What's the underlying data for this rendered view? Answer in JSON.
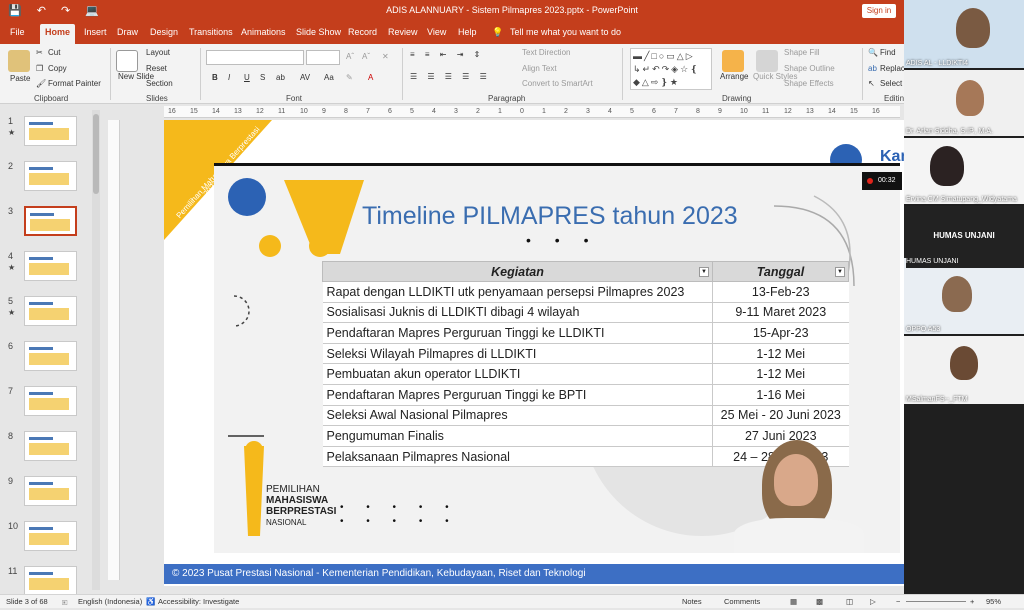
{
  "window": {
    "title": "ADIS ALANNUARY - Sistem Pilmapres 2023.pptx - PowerPoint",
    "signin_label": "Sign in"
  },
  "tabs": [
    "File",
    "Home",
    "Insert",
    "Draw",
    "Design",
    "Transitions",
    "Animations",
    "Slide Show",
    "Record",
    "Review",
    "View",
    "Help"
  ],
  "active_tab": "Home",
  "tell_me": "Tell me what you want to do",
  "ribbon": {
    "clipboard": {
      "label": "Clipboard",
      "paste": "Paste",
      "cut": "Cut",
      "copy": "Copy",
      "format_painter": "Format Painter"
    },
    "slides": {
      "label": "Slides",
      "new_slide": "New Slide",
      "layout": "Layout",
      "reset": "Reset",
      "section": "Section"
    },
    "font": {
      "label": "Font",
      "bold": "B",
      "italic": "I",
      "underline": "U",
      "strike": "S",
      "shadow": "ab",
      "case": "AV",
      "aa": "Aa",
      "font_color": "A"
    },
    "paragraph": {
      "label": "Paragraph",
      "text_direction": "Text Direction",
      "align_text": "Align Text",
      "smartart": "Convert to SmartArt"
    },
    "drawing": {
      "label": "Drawing",
      "arrange": "Arrange",
      "quick_styles": "Quick Styles",
      "shape_fill": "Shape Fill",
      "shape_outline": "Shape Outline",
      "shape_effects": "Shape Effects"
    },
    "editing": {
      "label": "Editing",
      "find": "Find",
      "replace": "Replac",
      "select": "Select"
    }
  },
  "thumbnails": [
    {
      "num": "1",
      "star": "★"
    },
    {
      "num": "2",
      "star": ""
    },
    {
      "num": "3",
      "star": ""
    },
    {
      "num": "4",
      "star": "★"
    },
    {
      "num": "5",
      "star": "★"
    },
    {
      "num": "6",
      "star": ""
    },
    {
      "num": "7",
      "star": ""
    },
    {
      "num": "8",
      "star": ""
    },
    {
      "num": "9",
      "star": ""
    },
    {
      "num": "10",
      "star": ""
    },
    {
      "num": "11",
      "star": ""
    }
  ],
  "ruler_ticks": [
    "16",
    "15",
    "14",
    "13",
    "12",
    "11",
    "10",
    "9",
    "8",
    "7",
    "6",
    "5",
    "4",
    "3",
    "2",
    "1",
    "0",
    "1",
    "2",
    "3",
    "4",
    "5",
    "6",
    "7",
    "8",
    "9",
    "10",
    "11",
    "12",
    "13",
    "14",
    "15",
    "16"
  ],
  "slide": {
    "banner_text": "Pemilihan Mahasiswa Berprestasi",
    "banner_year": "2023",
    "title": "Timeline PILMAPRES tahun 2023",
    "table": {
      "headers": [
        "Kegiatan",
        "Tanggal"
      ],
      "rows": [
        [
          "Rapat dengan LLDIKTI utk penyamaan persepsi Pilmapres 2023",
          "13-Feb-23"
        ],
        [
          "Sosialisasi Juknis di LLDIKTI dibagi 4 wilayah",
          "9-11 Maret 2023"
        ],
        [
          "Pendaftaran Mapres Perguruan Tinggi ke LLDIKTI",
          "15-Apr-23"
        ],
        [
          "Seleksi Wilayah Pilmapres di LLDIKTI",
          "1-12 Mei"
        ],
        [
          "Pembuatan akun operator LLDIKTI",
          "1-12 Mei"
        ],
        [
          "Pendaftaran Mapres Perguruan Tinggi ke BPTI",
          "1-16 Mei"
        ],
        [
          "Seleksi Awal Nasional Pilmapres",
          "25 Mei - 20 Juni 2023"
        ],
        [
          "Pengumuman Finalis",
          "27 Juni 2023"
        ],
        [
          "Pelaksanaan Pilmapres Nasional",
          "24 – 28 Juli 2023"
        ]
      ]
    },
    "logo_lines": [
      "PEMILIHAN",
      "MAHASISWA",
      "BERPRESTASI",
      "NASIONAL"
    ],
    "footer": "© 2023 Pusat Prestasi Nasional - Kementerian Pendidikan, Kebudayaan, Riset dan Teknologi",
    "corner_text": "Kam",
    "recording_time": "00:32"
  },
  "participants": [
    {
      "name": "ADIS AL - LLDIKTI4"
    },
    {
      "name": "Dr. Arlan Siddha, S.IP., M.A."
    },
    {
      "name": "Ervina CM Simatupang_Widyatama"
    },
    {
      "name": "HUMAS UNJANI",
      "label": "HUMAS UNJANI"
    },
    {
      "name": "OPPO A53"
    },
    {
      "name": "MSalmanFS--_FTM"
    }
  ],
  "status": {
    "slide_count": "Slide 3 of 68",
    "language": "English (Indonesia)",
    "accessibility": "Accessibility: Investigate",
    "notes": "Notes",
    "comments": "Comments",
    "zoom": "95%"
  },
  "colors": {
    "accent": "#c43e1c",
    "footer_blue": "#3d6fc4",
    "title_blue": "#3a6db0",
    "banner_yellow": "#f5b91b"
  }
}
